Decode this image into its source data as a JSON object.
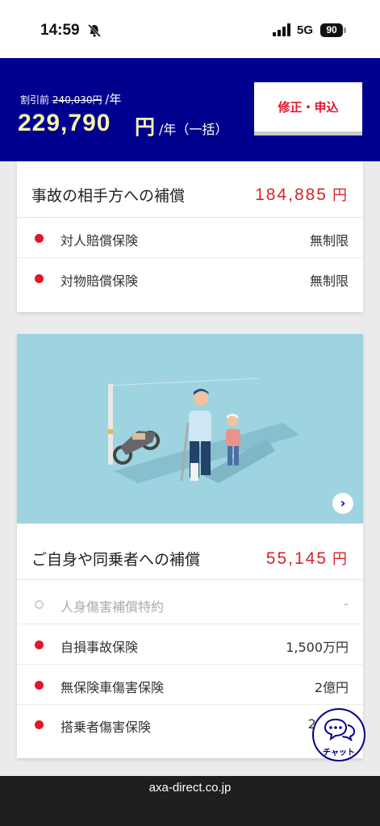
{
  "status_bar": {
    "time": "14:59",
    "network": "5G",
    "battery": "90",
    "icons": [
      "bell-slash-icon",
      "signal-icon",
      "battery-icon"
    ]
  },
  "price_header": {
    "discount_label": "割引前",
    "original_price": "240,030円",
    "original_unit": "/年",
    "price": "229,790",
    "price_unit": "円",
    "period": "/年（一括）",
    "apply_button": "修正・申込",
    "background_color": "#00008f",
    "price_color": "#f7f3a8",
    "button_text_color": "#e4162c"
  },
  "card1": {
    "title": "事故の相手方への補償",
    "amount": "184,885",
    "yen": "円",
    "rows": [
      {
        "label": "対人賠償保険",
        "value": "無制限",
        "active": true
      },
      {
        "label": "対物賠償保険",
        "value": "無制限",
        "active": true
      }
    ]
  },
  "card2": {
    "illustration": "accident-illustration",
    "next_icon": "chevron-right-icon",
    "title": "ご自身や同乗者への補償",
    "amount": "55,145",
    "yen": "円",
    "rows": [
      {
        "label": "人身傷害補償特約",
        "value": "-",
        "active": false
      },
      {
        "label": "自損事故保険",
        "value": "1,500万円",
        "active": true
      },
      {
        "label": "無保険車傷害保険",
        "value": "2億円",
        "active": true
      },
      {
        "label": "搭乗者傷害保険",
        "value": "20",
        "active": true
      }
    ]
  },
  "chat": {
    "label": "チャット",
    "icon": "chat-bubbles-icon"
  },
  "url_bar": {
    "url": "axa-direct.co.jp"
  }
}
